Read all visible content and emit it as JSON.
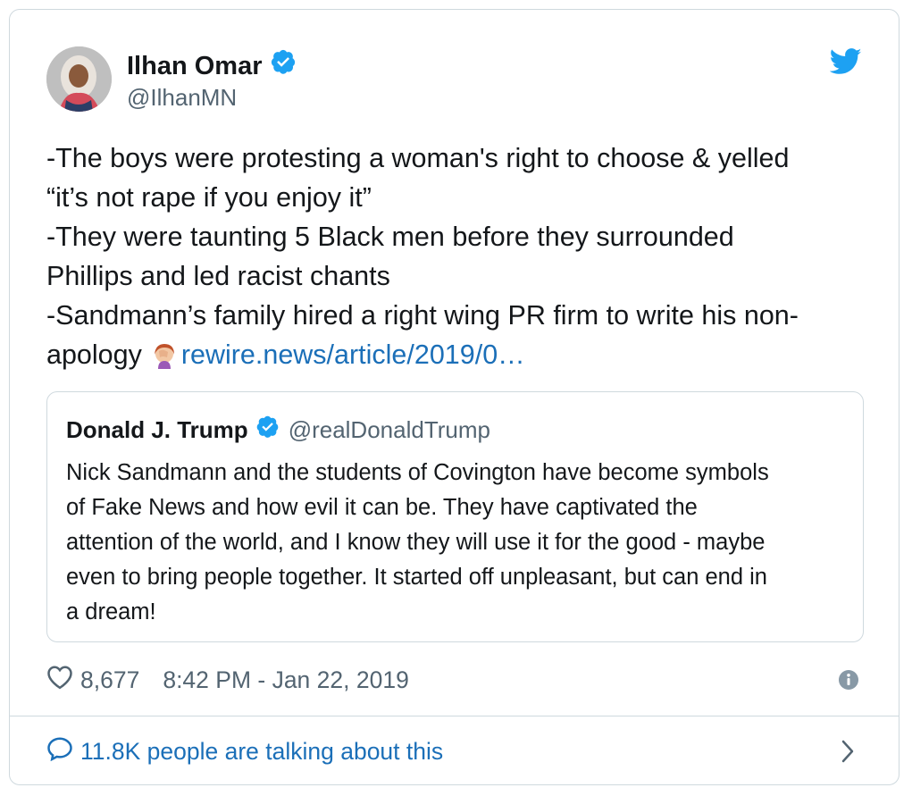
{
  "author": {
    "name": "Ilhan Omar",
    "handle": "@IlhanMN",
    "verified_icon": "verified-badge-icon"
  },
  "tweet": {
    "lines": [
      "-The boys were protesting a woman's right to choose & yelled",
      "“it’s not rape if you enjoy it”",
      "-They were taunting 5 Black men before they surrounded",
      "Phillips and led racist chants",
      "-Sandmann’s family hired a right wing PR firm to write his non-"
    ],
    "last_line_text": "apology",
    "emoji": "face-palm-emoji",
    "link_text": "rewire.news/article/2019/0…"
  },
  "quoted": {
    "name": "Donald J. Trump",
    "handle": "@realDonaldTrump",
    "lines": [
      "Nick Sandmann and the students of Covington have become symbols",
      "of Fake News and how evil it can be. They have captivated the",
      "attention of the world, and I know they will use it for the good - maybe",
      "even to bring people together. It started off unpleasant, but can end in",
      "a dream!"
    ]
  },
  "footer": {
    "likes": "8,677",
    "timestamp": "8:42 PM - Jan 22, 2019",
    "talking": "11.8K people are talking about this"
  },
  "colors": {
    "brand": "#1da1f2",
    "link": "#1b6fb8",
    "muted": "#536471",
    "border": "#cfd9de"
  }
}
